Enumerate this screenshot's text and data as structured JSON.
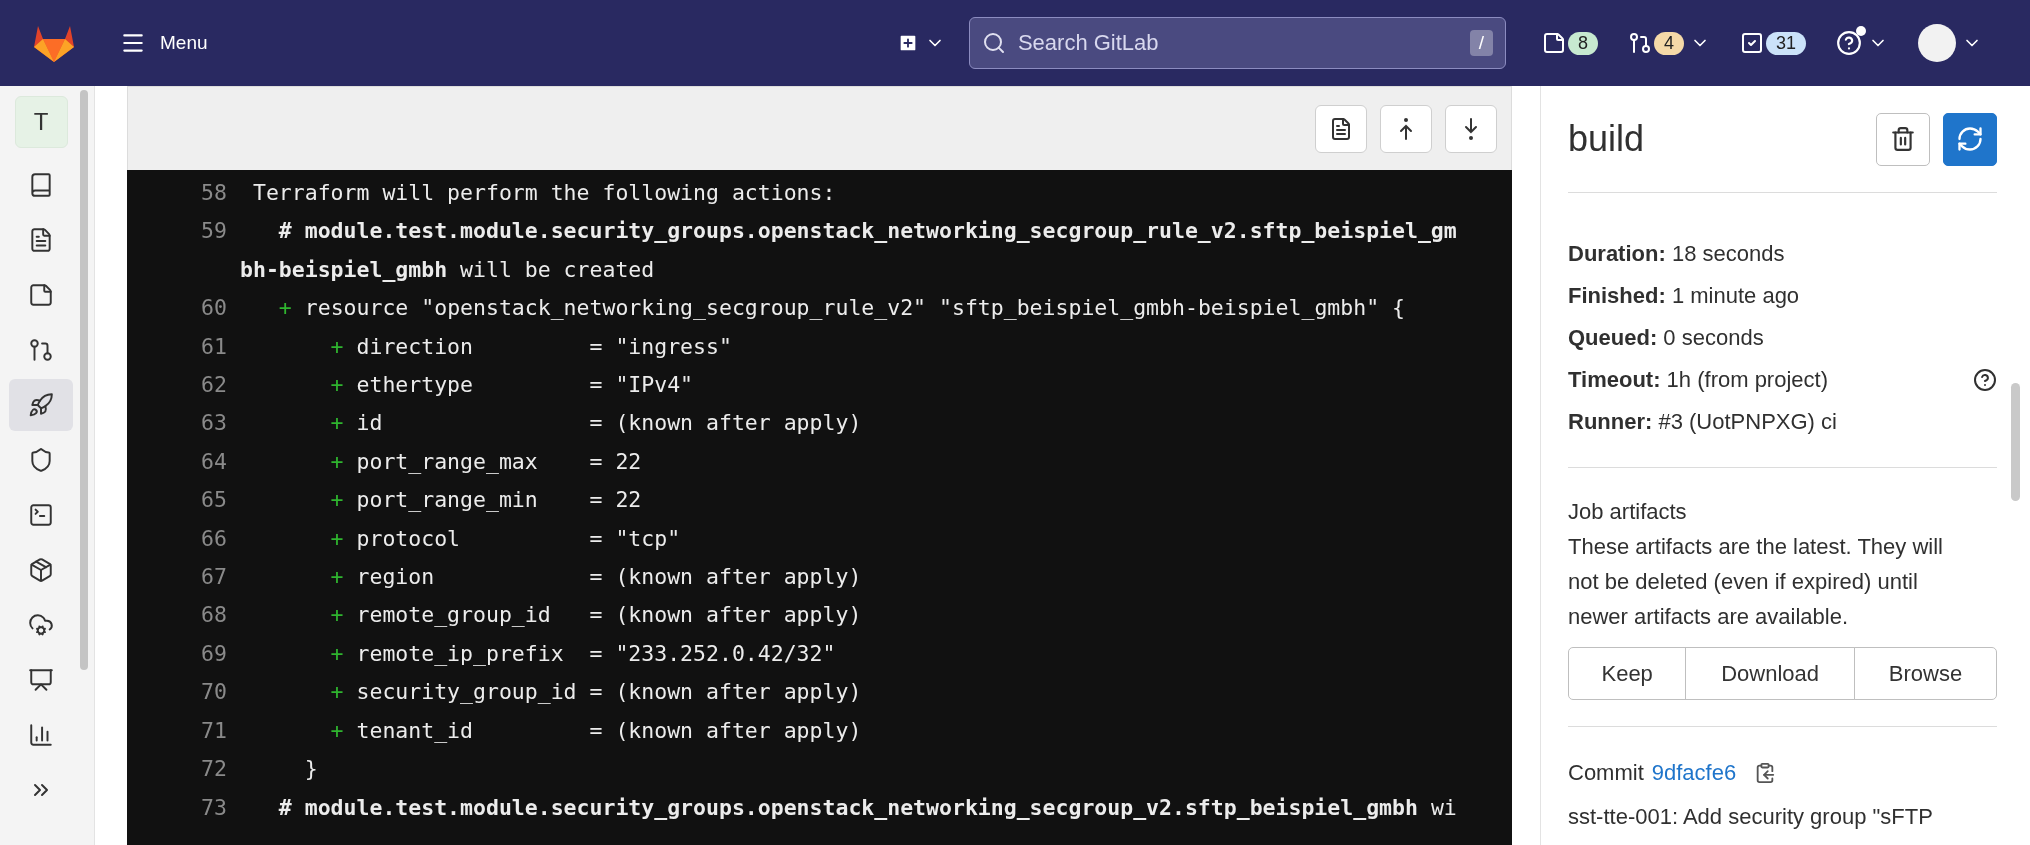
{
  "topbar": {
    "menu_label": "Menu",
    "search": {
      "placeholder": "Search GitLab",
      "shortcut": "/"
    },
    "counters": [
      {
        "count": "8",
        "color": "#c7e9d0"
      },
      {
        "count": "4",
        "color": "#f5d9a8"
      },
      {
        "count": "31",
        "color": "#cbe2f9"
      }
    ]
  },
  "sidebar": {
    "project_initial": "T",
    "items": [
      {
        "selected": false
      },
      {
        "selected": false
      },
      {
        "selected": false
      },
      {
        "selected": false
      },
      {
        "selected": true
      },
      {
        "selected": false
      },
      {
        "selected": false
      },
      {
        "selected": false
      },
      {
        "selected": false
      },
      {
        "selected": false
      },
      {
        "selected": false
      }
    ]
  },
  "log": {
    "lines": [
      {
        "number": "58",
        "segments": [
          {
            "kind": "plain",
            "text": " Terraform will perform the following actions:"
          }
        ]
      },
      {
        "number": "59",
        "segments": [
          {
            "kind": "bold",
            "text": "   # module.test.module.security_groups.openstack_networking_secgroup_rule_v2.sftp_beispiel_gmbh-beispiel_gmbh"
          },
          {
            "kind": "plain",
            "text": " will be created"
          }
        ]
      },
      {
        "number": "60",
        "segments": [
          {
            "kind": "diff",
            "text": "   +"
          },
          {
            "kind": "plain",
            "text": " resource \"openstack_networking_secgroup_rule_v2\" \"sftp_beispiel_gmbh-beispiel_gmbh\" {"
          }
        ]
      },
      {
        "number": "61",
        "segments": [
          {
            "kind": "diff",
            "text": "       +"
          },
          {
            "kind": "plain",
            "text": " direction         = \"ingress\""
          }
        ]
      },
      {
        "number": "62",
        "segments": [
          {
            "kind": "diff",
            "text": "       +"
          },
          {
            "kind": "plain",
            "text": " ethertype         = \"IPv4\""
          }
        ]
      },
      {
        "number": "63",
        "segments": [
          {
            "kind": "diff",
            "text": "       +"
          },
          {
            "kind": "plain",
            "text": " id                = (known after apply)"
          }
        ]
      },
      {
        "number": "64",
        "segments": [
          {
            "kind": "diff",
            "text": "       +"
          },
          {
            "kind": "plain",
            "text": " port_range_max    = 22"
          }
        ]
      },
      {
        "number": "65",
        "segments": [
          {
            "kind": "diff",
            "text": "       +"
          },
          {
            "kind": "plain",
            "text": " port_range_min    = 22"
          }
        ]
      },
      {
        "number": "66",
        "segments": [
          {
            "kind": "diff",
            "text": "       +"
          },
          {
            "kind": "plain",
            "text": " protocol          = \"tcp\""
          }
        ]
      },
      {
        "number": "67",
        "segments": [
          {
            "kind": "diff",
            "text": "       +"
          },
          {
            "kind": "plain",
            "text": " region            = (known after apply)"
          }
        ]
      },
      {
        "number": "68",
        "segments": [
          {
            "kind": "diff",
            "text": "       +"
          },
          {
            "kind": "plain",
            "text": " remote_group_id   = (known after apply)"
          }
        ]
      },
      {
        "number": "69",
        "segments": [
          {
            "kind": "diff",
            "text": "       +"
          },
          {
            "kind": "plain",
            "text": " remote_ip_prefix  = \"233.252.0.42/32\""
          }
        ]
      },
      {
        "number": "70",
        "segments": [
          {
            "kind": "diff",
            "text": "       +"
          },
          {
            "kind": "plain",
            "text": " security_group_id = (known after apply)"
          }
        ]
      },
      {
        "number": "71",
        "segments": [
          {
            "kind": "diff",
            "text": "       +"
          },
          {
            "kind": "plain",
            "text": " tenant_id         = (known after apply)"
          }
        ]
      },
      {
        "number": "72",
        "segments": [
          {
            "kind": "plain",
            "text": "     }"
          }
        ]
      },
      {
        "number": "73",
        "segments": [
          {
            "kind": "bold",
            "text": "   # module.test.module.security_groups.openstack_networking_secgroup_v2.sftp_beispiel_gmbh"
          },
          {
            "kind": "plain",
            "text": " wi"
          }
        ]
      }
    ]
  },
  "job": {
    "title": "build",
    "details": [
      {
        "label": "Duration:",
        "value": "18 seconds"
      },
      {
        "label": "Finished:",
        "value": "1 minute ago"
      },
      {
        "label": "Queued:",
        "value": "0 seconds"
      },
      {
        "label": "Timeout:",
        "value": "1h (from project)",
        "help": true
      },
      {
        "label": "Runner:",
        "value": "#3 (UotPNPXG) ci"
      }
    ],
    "artifacts": {
      "title": "Job artifacts",
      "description": "These artifacts are the latest. They will not be deleted (even if expired) until newer artifacts are available.",
      "buttons": [
        "Keep",
        "Download",
        "Browse"
      ]
    },
    "commit": {
      "label": "Commit",
      "sha": "9dfacfe6",
      "message": "sst-tte-001: Add security group \"sFTP"
    }
  }
}
